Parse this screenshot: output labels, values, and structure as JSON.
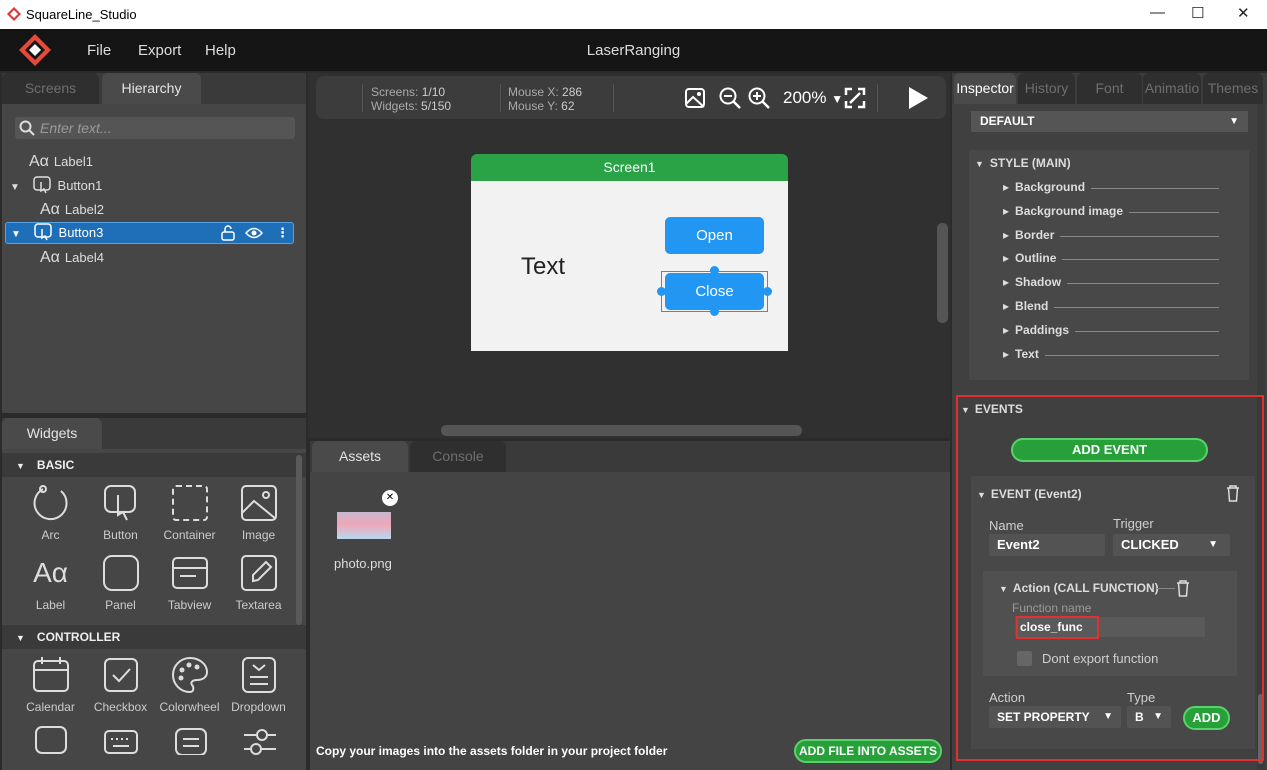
{
  "window": {
    "title": "SquareLine_Studio"
  },
  "menu": {
    "file": "File",
    "export": "Export",
    "help": "Help",
    "project_name": "LaserRanging"
  },
  "left_tabs": {
    "screens": "Screens",
    "hierarchy": "Hierarchy"
  },
  "hierarchy": {
    "search_placeholder": "Enter text...",
    "nodes": [
      {
        "label": "Label1",
        "type": "label"
      },
      {
        "label": "Button1",
        "type": "button"
      },
      {
        "label": "Label2",
        "type": "label"
      },
      {
        "label": "Button3",
        "type": "button",
        "selected": true
      },
      {
        "label": "Label4",
        "type": "label"
      }
    ]
  },
  "widgets": {
    "tab": "Widgets",
    "basic_label": "BASIC",
    "basic": [
      "Arc",
      "Button",
      "Container",
      "Image",
      "Label",
      "Panel",
      "Tabview",
      "Textarea"
    ],
    "controller_label": "CONTROLLER",
    "controller": [
      "Calendar",
      "Checkbox",
      "Colorwheel",
      "Dropdown"
    ]
  },
  "toolbar": {
    "screens_label": "Screens:",
    "screens_value": "1/10",
    "widgets_label": "Widgets:",
    "widgets_value": "5/150",
    "mousex_label": "Mouse X:",
    "mousex_value": "286",
    "mousey_label": "Mouse Y:",
    "mousey_value": "62",
    "zoom": "200%"
  },
  "canvas": {
    "screen_name": "Screen1",
    "text_label": "Text",
    "open_button": "Open",
    "close_button": "Close"
  },
  "assets": {
    "tab_assets": "Assets",
    "tab_console": "Console",
    "file_name": "photo.png",
    "hint": "Copy your images into the assets folder in your project folder",
    "add_button": "ADD FILE INTO ASSETS"
  },
  "inspector": {
    "tabs": [
      "Inspector",
      "History",
      "Font",
      "Animatio",
      "Themes"
    ],
    "state_dropdown": "DEFAULT",
    "style_main": "STYLE (MAIN)",
    "style_items": [
      "Background",
      "Background image",
      "Border",
      "Outline",
      "Shadow",
      "Blend",
      "Paddings",
      "Text"
    ],
    "events_label": "EVENTS",
    "add_event": "ADD EVENT",
    "event_title": "EVENT (Event2)",
    "name_label": "Name",
    "name_value": "Event2",
    "trigger_label": "Trigger",
    "trigger_value": "CLICKED",
    "action_title": "Action (CALL FUNCTION)",
    "function_name_label": "Function name",
    "function_name_value": "close_func",
    "dont_export": "Dont export function",
    "action_label": "Action",
    "action_value": "SET PROPERTY",
    "type_label": "Type",
    "type_value": "B",
    "add": "ADD"
  },
  "colors": {
    "accent_green": "#27a03a",
    "selection_blue": "#1e6fb8",
    "button_blue": "#2196f3",
    "highlight_red": "#e03030"
  }
}
